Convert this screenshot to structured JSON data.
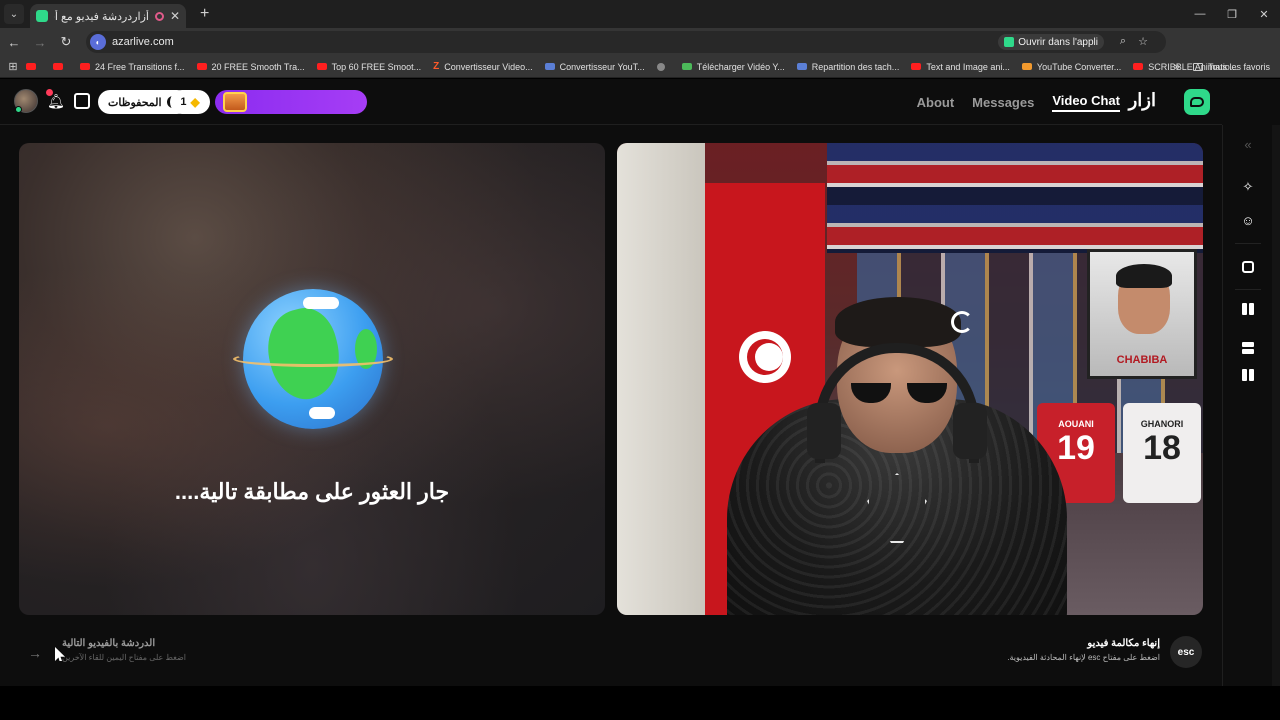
{
  "browser": {
    "tab_title": "أزاردردشة فيديو مع أشخاص",
    "tab_close": "✕",
    "new_tab": "+",
    "tab_menu": "⌄",
    "url": "azarlive.com",
    "open_in_app": "Ouvrir dans l'appli",
    "profile_initial": "G",
    "bookmarks": [
      {
        "label": "",
        "icon": "youtube-icon"
      },
      {
        "label": "",
        "icon": "youtube-icon"
      },
      {
        "label": "24 Free Transitions f...",
        "icon": "youtube-icon"
      },
      {
        "label": "20 FREE Smooth Tra...",
        "icon": "youtube-icon"
      },
      {
        "label": "Top 60 FREE Smoot...",
        "icon": "youtube-icon"
      },
      {
        "label": "Convertisseur Video...",
        "icon": "z-icon"
      },
      {
        "label": "Convertisseur YouT...",
        "icon": "converter-icon"
      },
      {
        "label": "",
        "icon": "globe-icon"
      },
      {
        "label": "Télécharger Vidéo Y...",
        "icon": "download-icon"
      },
      {
        "label": "Repartition des tach...",
        "icon": "doc-icon"
      },
      {
        "label": "Text and Image ani...",
        "icon": "youtube-icon"
      },
      {
        "label": "YouTube Converter...",
        "icon": "star-icon"
      },
      {
        "label": "SCRIBBLE Animatio...",
        "icon": "youtube-icon"
      }
    ],
    "all_bookmarks": "Tous les favoris"
  },
  "header": {
    "saved_label": "المحفوظات",
    "gems_count": "1",
    "nav": {
      "about": "About",
      "messages": "Messages",
      "video_chat": "Video Chat"
    },
    "brand": "ازار"
  },
  "main": {
    "matching_text": "جار العثور على مطابقة تالية....",
    "poster_label": "CHABIBA",
    "jersey1": {
      "name": "AOUANI",
      "number": "19"
    },
    "jersey2": {
      "name": "GHANORI",
      "number": "18"
    }
  },
  "controls": {
    "next_title": "الدردشة بالفيديو التالية",
    "next_hint": "اضغط على مفتاح اليمين للقاء الآخرين",
    "end_title": "إنهاء مكالمة فيديو",
    "end_hint": "اضغط على مفتاح esc لإنهاء المحادثة الفيديوية.",
    "esc_label": "esc"
  },
  "colors": {
    "brand": "#2fd98a",
    "promo": "#9b35f3",
    "notification": "#ff3b5a"
  }
}
